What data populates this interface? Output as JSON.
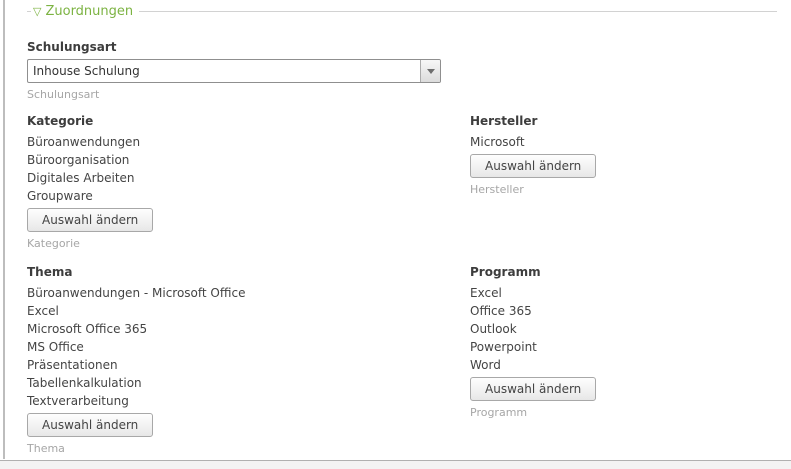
{
  "header": {
    "title": "Zuordnungen",
    "collapse_icon": "triangle-down-outline-icon"
  },
  "schulungsart": {
    "label": "Schulungsart",
    "value": "Inhouse Schulung",
    "caption": "Schulungsart"
  },
  "sections": {
    "kategorie": {
      "label": "Kategorie",
      "items": [
        "Büroanwendungen",
        "Büroorganisation",
        "Digitales Arbeiten",
        "Groupware"
      ],
      "button_label": "Auswahl ändern",
      "caption": "Kategorie"
    },
    "hersteller": {
      "label": "Hersteller",
      "items": [
        "Microsoft"
      ],
      "button_label": "Auswahl ändern",
      "caption": "Hersteller"
    },
    "thema": {
      "label": "Thema",
      "items": [
        "Büroanwendungen - Microsoft Office",
        "Excel",
        "Microsoft Office 365",
        "MS Office",
        "Präsentationen",
        "Tabellenkalkulation",
        "Textverarbeitung"
      ],
      "button_label": "Auswahl ändern",
      "caption": "Thema"
    },
    "programm": {
      "label": "Programm",
      "items": [
        "Excel",
        "Office 365",
        "Outlook",
        "Powerpoint",
        "Word"
      ],
      "button_label": "Auswahl ändern",
      "caption": "Programm"
    }
  },
  "colors": {
    "accent_green": "#7cb342",
    "caption_gray": "#a6a6a6",
    "rule_gray": "#d2d2d2"
  },
  "icons": {
    "collapse_glyph": "▽"
  }
}
